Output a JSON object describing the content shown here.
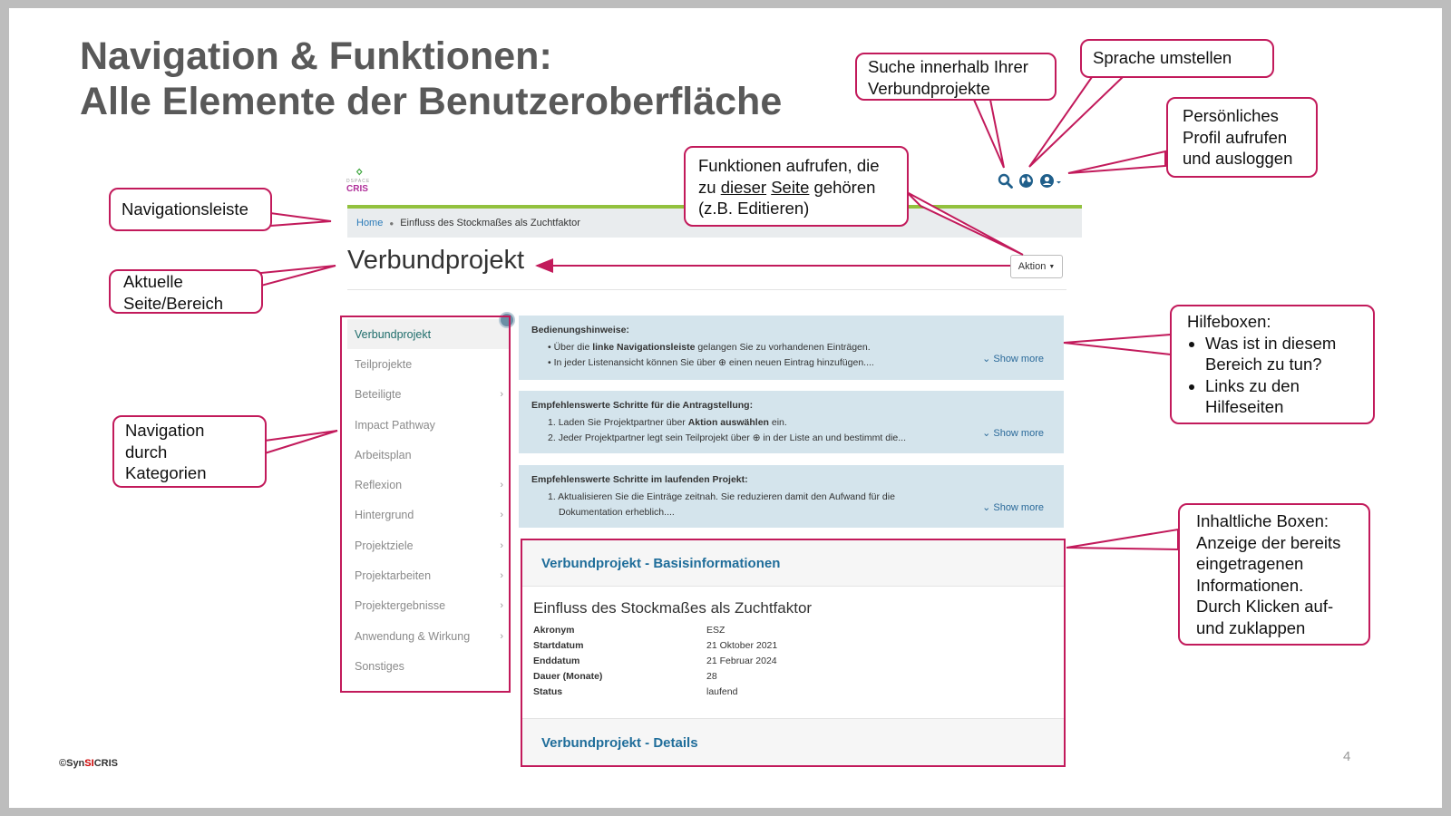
{
  "slide": {
    "title_line1": "Navigation & Funktionen:",
    "title_line2": "Alle Elemente der Benutzeroberfläche",
    "copyright_pre": "©Syn",
    "copyright_mid": "SI",
    "copyright_post": "CRIS",
    "page_number": "4"
  },
  "app": {
    "logo_small": "DSPACE",
    "logo_name": "CRIS",
    "icons": [
      "search-icon",
      "globe-icon",
      "user-icon"
    ],
    "breadcrumb": {
      "home": "Home",
      "current": "Einfluss des Stockmaßes als Zuchtfaktor"
    },
    "page_title": "Verbundprojekt",
    "action_button": "Aktion",
    "sidebar": [
      {
        "label": "Verbundprojekt",
        "active": true,
        "chevron": false
      },
      {
        "label": "Teilprojekte",
        "active": false,
        "chevron": false
      },
      {
        "label": "Beteiligte",
        "active": false,
        "chevron": true
      },
      {
        "label": "Impact Pathway",
        "active": false,
        "chevron": false
      },
      {
        "label": "Arbeitsplan",
        "active": false,
        "chevron": false
      },
      {
        "label": "Reflexion",
        "active": false,
        "chevron": true
      },
      {
        "label": "Hintergrund",
        "active": false,
        "chevron": true
      },
      {
        "label": "Projektziele",
        "active": false,
        "chevron": true
      },
      {
        "label": "Projektarbeiten",
        "active": false,
        "chevron": true
      },
      {
        "label": "Projektergebnisse",
        "active": false,
        "chevron": true
      },
      {
        "label": "Anwendung & Wirkung",
        "active": false,
        "chevron": true
      },
      {
        "label": "Sonstiges",
        "active": false,
        "chevron": false
      }
    ],
    "help_boxes": {
      "box1": {
        "title": "Bedienungshinweise:",
        "line1_pre": "Über die ",
        "line1_bold": "linke Navigationsleiste",
        "line1_post": " gelangen Sie zu vorhandenen Einträgen.",
        "line2_pre": "In jeder Listenansicht können Sie über ",
        "line2_post": " einen neuen Eintrag hinzufügen....",
        "show_more": "Show more"
      },
      "box2": {
        "title": "Empfehlenswerte Schritte für die Antragstellung:",
        "line1_pre": "Laden Sie Projektpartner über ",
        "line1_bold": "Aktion auswählen",
        "line1_post": " ein.",
        "line2_pre": "Jeder Projektpartner legt sein Teilprojekt über ",
        "line2_post": " in der Liste an und bestimmt die...",
        "show_more": "Show more"
      },
      "box3": {
        "title": "Empfehlenswerte Schritte im laufenden Projekt:",
        "line1": "Aktualisieren Sie die Einträge zeitnah. Sie reduzieren damit den Aufwand für die",
        "line2": "Dokumentation erheblich....",
        "show_more": "Show more"
      }
    },
    "content_box": {
      "head1": "Verbundprojekt - Basisinformationen",
      "project_title": "Einfluss des Stockmaßes als Zuchtfaktor",
      "fields": [
        {
          "key": "Akronym",
          "value": "ESZ"
        },
        {
          "key": "Startdatum",
          "value": "21 Oktober 2021"
        },
        {
          "key": "Enddatum",
          "value": "21 Februar 2024"
        },
        {
          "key": "Dauer (Monate)",
          "value": "28"
        },
        {
          "key": "Status",
          "value": "laufend"
        }
      ],
      "head2": "Verbundprojekt - Details"
    }
  },
  "callouts": {
    "navigationsleiste": "Navigationsleiste",
    "aktuelle_line1": "Aktuelle",
    "aktuelle_line2": "Seite/Bereich",
    "nav_kat_line1": "Navigation",
    "nav_kat_line2": "durch",
    "nav_kat_line3": "Kategorien",
    "suche_line1": "Suche innerhalb Ihrer",
    "suche_line2": "Verbundprojekte",
    "sprache": "Sprache umstellen",
    "profil_line1": "Persönliches",
    "profil_line2": "Profil aufrufen",
    "profil_line3": "und ausloggen",
    "funktionen_line1": "Funktionen aufrufen, die",
    "funktionen_pre": "zu ",
    "funktionen_u1": "dieser",
    "funktionen_u2": "Seite",
    "funktionen_post": " gehören",
    "funktionen_line3": "(z.B. Editieren)",
    "hilfe_title": "Hilfeboxen:",
    "hilfe_b1": "Was ist in diesem Bereich zu tun?",
    "hilfe_b2": "Links zu den Hilfeseiten",
    "inhalt_line1": "Inhaltliche Boxen:",
    "inhalt_line2": "Anzeige der bereits",
    "inhalt_line3": "eingetragenen",
    "inhalt_line4": "Informationen.",
    "inhalt_line5": "Durch Klicken auf-",
    "inhalt_line6": "und zuklappen"
  },
  "colors": {
    "accent": "#c21a5b",
    "help_bg": "#d4e4ec",
    "link": "#1f6d9a",
    "green_line": "#92c13e"
  }
}
